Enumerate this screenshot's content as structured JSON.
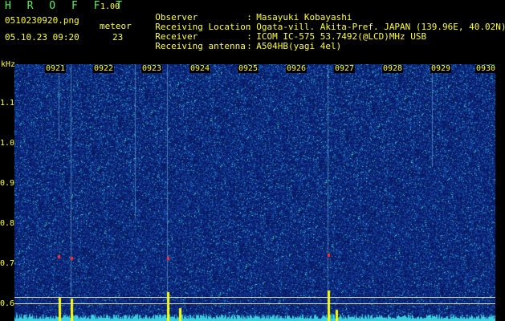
{
  "header": {
    "app_title": "H R O F F T",
    "app_version": "1.00",
    "filename": "0510230920.png",
    "meteor_label": "meteor",
    "datetime": "05.10.23 09:20",
    "meteor_count": "23"
  },
  "info": [
    {
      "label": "Observer",
      "value": "Masayuki Kobayashi"
    },
    {
      "label": "Receiving Location",
      "value": "Ogata-vill. Akita-Pref. JAPAN (139.96E, 40.02N)"
    },
    {
      "label": "Receiver",
      "value": "ICOM IC-575 53.7492(@LCD)MHz USB"
    },
    {
      "label": "Receiving antenna",
      "value": "A504HB(yagi 4el)"
    }
  ],
  "spectrogram": {
    "y_unit": "kHz",
    "y_ticks": [
      "1.1",
      "1.0",
      "0.9",
      "0.8",
      "0.7",
      "0.6"
    ],
    "x_ticks": [
      "0921",
      "0922",
      "0923",
      "0924",
      "0925",
      "0926",
      "0927",
      "0928",
      "0929",
      "0930"
    ],
    "colors": {
      "background": "#000000",
      "noise_low": "#0a1a6a",
      "noise_high": "#3ad0d0",
      "spike": "#ffff00",
      "meteor": "#ff3030"
    }
  }
}
